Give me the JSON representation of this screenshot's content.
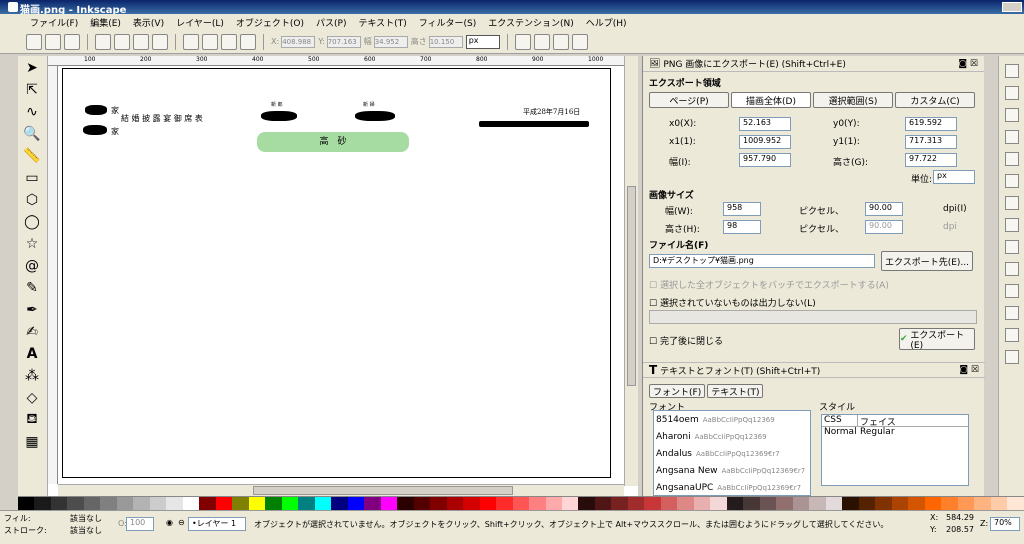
{
  "window": {
    "title": "猫画.png - Inkscape",
    "corner_marker": "░ ∙"
  },
  "menu": [
    "ファイル(F)",
    "編集(E)",
    "表示(V)",
    "レイヤー(L)",
    "オブジェクト(O)",
    "パス(P)",
    "テキスト(T)",
    "フィルター(S)",
    "エクステンション(N)",
    "ヘルプ(H)"
  ],
  "toolbar": {
    "x_label": "X:",
    "x_value": "408.988",
    "y_label": "Y:",
    "y_value": "707.163",
    "w_label": "幅",
    "w_value": "34.952",
    "h_label": "高さ",
    "h_value": "10.150",
    "unit": "px"
  },
  "ruler": [
    "100",
    "200",
    "300",
    "400",
    "500",
    "600",
    "700",
    "800",
    "900",
    "1000"
  ],
  "document": {
    "kanji1": "家",
    "kanji2": "家",
    "title": "結 婚 披 露 宴 御 席 表",
    "groom_label": "新 郎",
    "bride_label": "新 婦",
    "date": "平成28年7月16日",
    "head_table": "高　砂"
  },
  "export": {
    "panel_title": "PNG 画像にエクスポート(E) (Shift+Ctrl+E)",
    "area_label": "エクスポート領域",
    "area_buttons": [
      "ページ(P)",
      "描画全体(D)",
      "選択範囲(S)",
      "カスタム(C)"
    ],
    "x0_label": "x0(X):",
    "x0": "52.163",
    "y0_label": "y0(Y):",
    "y0": "619.592",
    "x1_label": "x1(1):",
    "x1": "1009.952",
    "y1_label": "y1(1):",
    "y1": "717.313",
    "w_label": "幅(I):",
    "w": "957.790",
    "h_label": "高さ(G):",
    "h": "97.722",
    "unit_label": "単位:",
    "unit": "px",
    "image_size_label": "画像サイズ",
    "img_w_label": "幅(W):",
    "img_w": "958",
    "img_h_label": "高さ(H):",
    "img_h": "98",
    "pixel_label": "ピクセル、",
    "dpi_value": "90.00",
    "dpi_label": "dpi(I)",
    "dpi_value2": "90.00",
    "dpi_label2": "dpi",
    "filename_label": "ファイル名(F)",
    "filename": "D:¥デスクトップ¥猫画.png",
    "export_as": "エクスポート先(E)...",
    "batch_label": "選択した全オブジェクトをバッチでエクスポートする(A)",
    "hide_label": "選択されていないものは出力しない(L)",
    "close_label": "完了後に閉じる",
    "export_button": "エクスポート(E)"
  },
  "textfont": {
    "panel_title": "テキストとフォント(T) (Shift+Ctrl+T)",
    "tabs": [
      "フォント(F)",
      "テキスト(T)"
    ],
    "font_label": "フォント",
    "style_label": "スタイル",
    "fonts": [
      {
        "name": "8514oem",
        "sample": "AaBbCcIiPpQq12369"
      },
      {
        "name": "Aharoni",
        "sample": "AaBbCcIiPpQq12369"
      },
      {
        "name": "Andalus",
        "sample": "AaBbCcIiPpQq12369€r7"
      },
      {
        "name": "Angsana New",
        "sample": "AaBbCcIiPpQq12369€r7"
      },
      {
        "name": "AngsanaUPC",
        "sample": "AaBbCcIiPpQq12369€r7"
      }
    ],
    "style_cols": [
      "CSS",
      "フェイス"
    ],
    "style_row": [
      "Normal",
      "Regular"
    ]
  },
  "status": {
    "fill_label": "フィル:",
    "fill_value": "該当なし",
    "stroke_label": "ストローク:",
    "stroke_value": "該当なし",
    "opacity_label": "O:",
    "opacity_value": "100",
    "layer": "•レイヤー 1",
    "message": "オブジェクトが選択されていません。オブジェクトをクリック、Shift+クリック、オブジェクト上で Alt+マウススクロール、または囲むようにドラッグして選択してください。",
    "cx_label": "X:",
    "cx": "584.29",
    "cy_label": "Y:",
    "cy": "208.57",
    "zoom_label": "Z:",
    "zoom": "70%"
  },
  "palette": [
    "#000000",
    "#1a1a1a",
    "#333333",
    "#4d4d4d",
    "#666666",
    "#808080",
    "#999999",
    "#b3b3b3",
    "#cccccc",
    "#e6e6e6",
    "#ffffff",
    "#800000",
    "#ff0000",
    "#808000",
    "#ffff00",
    "#008000",
    "#00ff00",
    "#008080",
    "#00ffff",
    "#000080",
    "#0000ff",
    "#800080",
    "#ff00ff",
    "#2b0000",
    "#550000",
    "#800000",
    "#aa0000",
    "#d40000",
    "#ff0000",
    "#ff2a2a",
    "#ff5555",
    "#ff8080",
    "#ffaaaa",
    "#ffd5d5",
    "#280b0b",
    "#501616",
    "#782121",
    "#a02c2c",
    "#c83737",
    "#d35f5f",
    "#de8787",
    "#e9afaf",
    "#f4d7d7",
    "#241c1c",
    "#483737",
    "#6c5353",
    "#916f6f",
    "#ac9393",
    "#c8b7b7",
    "#e3dbdb",
    "#2b1100",
    "#552200",
    "#803300",
    "#aa4400",
    "#d45500",
    "#ff6600",
    "#ff7f2a",
    "#ff9955",
    "#ffb380",
    "#ffccaa",
    "#ffe6d5"
  ]
}
